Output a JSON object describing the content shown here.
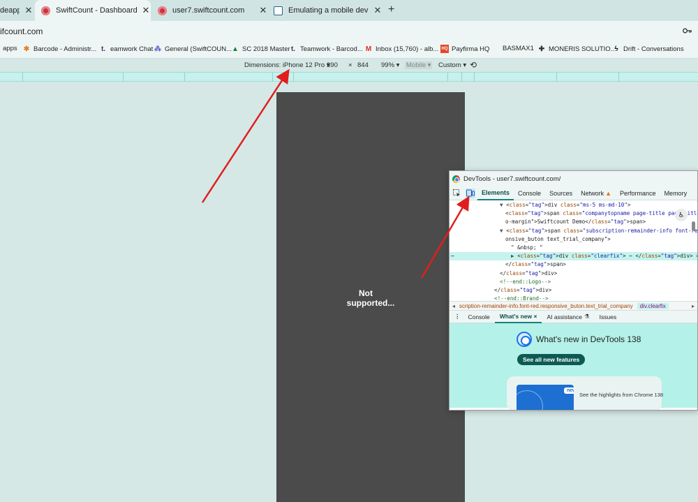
{
  "tabs": [
    {
      "title": "deapp",
      "active": false
    },
    {
      "title": "SwiftCount - Dashboard",
      "active": true
    },
    {
      "title": "user7.swiftcount.com",
      "active": false
    },
    {
      "title": "Emulating a mobile device from",
      "active": false
    }
  ],
  "address_bar": {
    "url": "ifcount.com"
  },
  "bookmarks": [
    {
      "label": "apps"
    },
    {
      "label": "Barcode - Administr..."
    },
    {
      "label": "eamwork Chat"
    },
    {
      "label": "General (SwiftCOUN..."
    },
    {
      "label": "SC 2018 Master"
    },
    {
      "label": "Teamwork - Barcod..."
    },
    {
      "label": "Inbox (15,760) - alb..."
    },
    {
      "label": "Payfirma HQ"
    },
    {
      "label": "BASMAX1"
    },
    {
      "label": "MONERIS SOLUTIO..."
    },
    {
      "label": "Drift - Conversations"
    }
  ],
  "device_toolbar": {
    "dimensions_label": "Dimensions: iPhone 12 Pro ▾",
    "width": "390",
    "times": "×",
    "height": "844",
    "zoom": "99% ▾",
    "mode": "Mobile ▾",
    "throttle": "Custom ▾"
  },
  "viewport": {
    "message_line1": "Not",
    "message_line2": "supported..."
  },
  "devtools": {
    "title": "DevTools - user7.swiftcount.com/",
    "tabs": [
      "Elements",
      "Console",
      "Sources",
      "Network",
      "Performance",
      "Memory"
    ],
    "active_tab": "Elements",
    "code_lines": [
      {
        "indent": 9,
        "tri": "▼",
        "html": "<div class=\"ms-5 ms-md-10\">"
      },
      {
        "indent": 10,
        "tri": "",
        "html": "<span class=\"companytopname page-title page-title-r..."
      },
      {
        "indent": 10,
        "tri": "",
        "html": "o-margin\">Swiftcount Demo</span>"
      },
      {
        "indent": 9,
        "tri": "▼",
        "html": "<span class=\"subscription-remainder-info font-red resp"
      },
      {
        "indent": 10,
        "tri": "",
        "html": "onsive_buton text_trial_company\">"
      },
      {
        "indent": 11,
        "tri": "",
        "html": "\" &nbsp; \""
      },
      {
        "indent": 11,
        "tri": "▶",
        "html": "<div class=\"clearfix\"> ⋯ </div> == $0"
      },
      {
        "indent": 10,
        "tri": "",
        "html": "</span>"
      },
      {
        "indent": 9,
        "tri": "",
        "html": "</div>"
      },
      {
        "indent": 9,
        "tri": "",
        "html": "<!--end::Logo-->"
      },
      {
        "indent": 8,
        "tri": "",
        "html": "</div>"
      },
      {
        "indent": 8,
        "tri": "",
        "html": "<!--end::Brand-->"
      }
    ],
    "breadcrumb_main": "scription-remainder-info.font-red.responsive_buton.text_trial_company",
    "breadcrumb_selected": "div.clearfix",
    "drawer_tabs": [
      "Console",
      "What's new ×",
      "AI assistance",
      "Issues"
    ],
    "drawer_active": "What's new ×",
    "whats_new_title": "What's new in DevTools 138",
    "see_all_label": "See all new features",
    "card_badge": "new",
    "card_text": "See the highlights from Chrome 138"
  },
  "colors": {
    "accent": "#1a7f7a",
    "arrow": "#e01e1e",
    "viewport_bg": "#4b4b4b"
  }
}
